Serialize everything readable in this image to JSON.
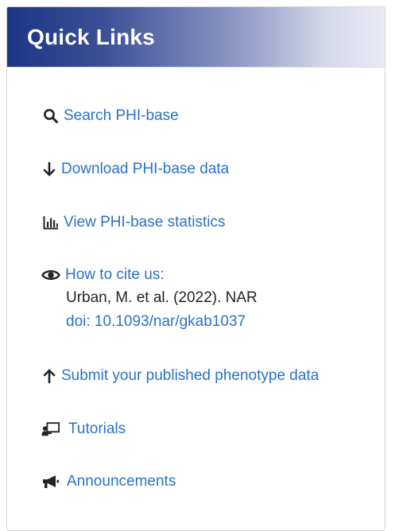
{
  "panel": {
    "title": "Quick Links"
  },
  "links": {
    "search": {
      "label": "Search PHI-base",
      "icon": "search-icon"
    },
    "download": {
      "label": "Download PHI-base data",
      "icon": "arrow-down-icon"
    },
    "statistics": {
      "label": "View PHI-base statistics",
      "icon": "bar-chart-icon"
    },
    "cite": {
      "label": "How to cite us:",
      "icon": "eye-icon",
      "reference": "Urban, M. et al. (2022). NAR",
      "doi": "doi: 10.1093/nar/gkab1037"
    },
    "submit": {
      "label": "Submit your published phenotype data",
      "icon": "arrow-up-icon"
    },
    "tutorials": {
      "label": "Tutorials",
      "icon": "chalkboard-teacher-icon"
    },
    "announcements": {
      "label": "Announcements",
      "icon": "megaphone-icon"
    }
  },
  "colors": {
    "header_start": "#1c3584",
    "header_end": "#ebebf4",
    "link": "#2a72c4",
    "text": "#212529"
  }
}
